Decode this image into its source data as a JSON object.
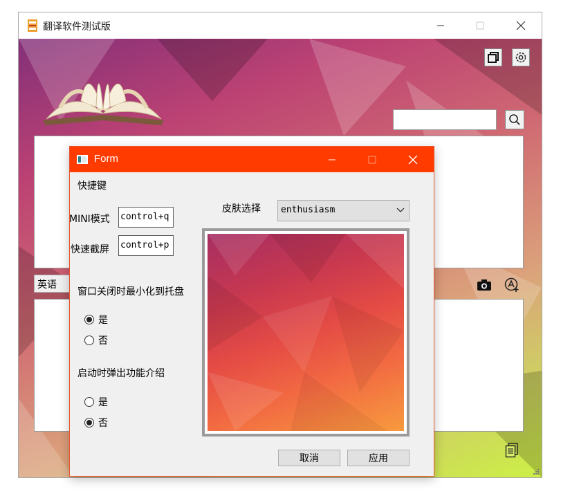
{
  "main_window": {
    "title": "翻译软件测试版",
    "search_value": "",
    "language": "英语"
  },
  "dialog": {
    "title": "Form",
    "shortcuts_label": "快捷键",
    "mini_mode_label": "MINI模式",
    "mini_mode_value": "control+q",
    "screenshot_label": "快速截屏",
    "screenshot_value": "control+p",
    "tray_question": "窗口关闭时最小化到托盘",
    "tray_yes": "是",
    "tray_no": "否",
    "tray_selected": "yes",
    "intro_question": "启动时弹出功能介绍",
    "intro_yes": "是",
    "intro_no": "否",
    "intro_selected": "no",
    "skin_label": "皮肤选择",
    "skin_value": "enthusiasm",
    "cancel_label": "取消",
    "apply_label": "应用"
  },
  "colors": {
    "dialog_titlebar": "#ff3b00",
    "dialog_border": "#e8552d",
    "background_start": "#7a1e6e",
    "background_end": "#cdf046"
  }
}
